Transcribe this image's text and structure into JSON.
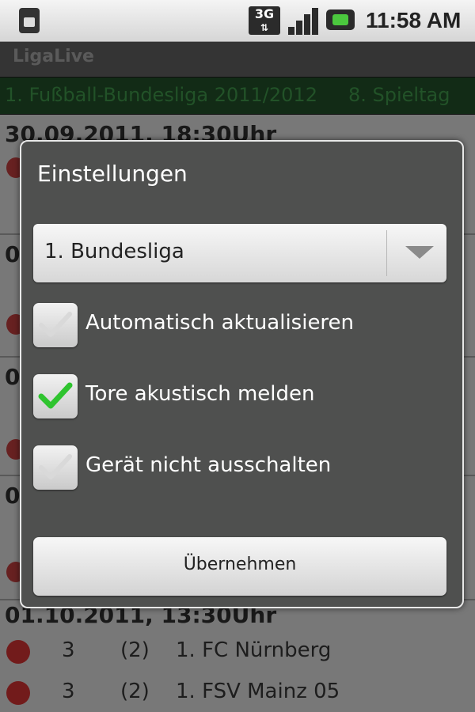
{
  "statusbar": {
    "network": "3G",
    "time": "11:58 AM"
  },
  "app": {
    "title": "LigaLive"
  },
  "league": {
    "name": "1. Fußball-Bundesliga 2011/2012",
    "matchday": "8. Spieltag"
  },
  "background": {
    "dates": [
      "30.09.2011, 18:30Uhr",
      "01.10.2011, 13:30Uhr"
    ],
    "partial_rows": [
      "0",
      "0",
      "0"
    ],
    "rows": [
      {
        "points": "3",
        "prev": "(2)",
        "team": "1. FC Nürnberg"
      },
      {
        "points": "3",
        "prev": "(2)",
        "team": "1. FSV Mainz 05"
      }
    ]
  },
  "dialog": {
    "title": "Einstellungen",
    "league_select": "1. Bundesliga",
    "options": [
      {
        "label": "Automatisch aktualisieren",
        "checked": false
      },
      {
        "label": "Tore akustisch melden",
        "checked": true
      },
      {
        "label": "Gerät nicht ausschalten",
        "checked": false
      }
    ],
    "apply_label": "Übernehmen"
  },
  "colors": {
    "check_green": "#2fc42f",
    "league_bar": "#1f4a26",
    "dialog_bg": "#4f504f"
  }
}
